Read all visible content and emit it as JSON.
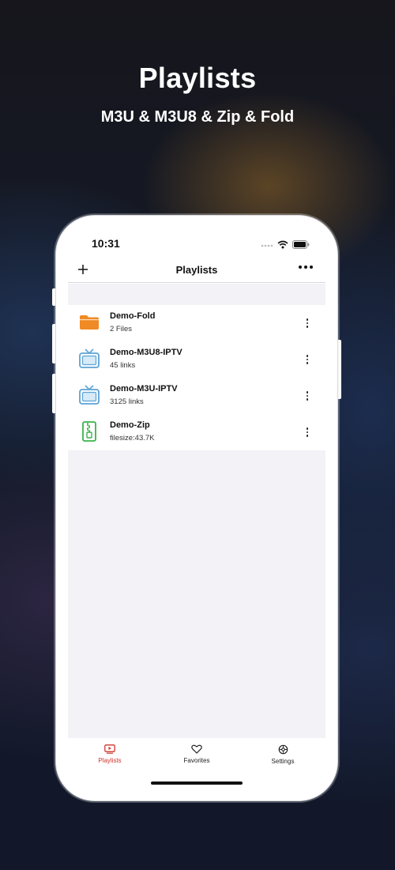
{
  "promo": {
    "headline": "Playlists",
    "subheadline": "M3U & M3U8 & Zip & Fold"
  },
  "status_bar": {
    "time": "10:31"
  },
  "navbar": {
    "title": "Playlists",
    "add_icon": "plus-icon",
    "more_icon": "more-horizontal-icon"
  },
  "playlists": [
    {
      "title": "Demo-Fold",
      "subtitle": "2 Files",
      "icon": "folder-icon",
      "icon_color": "#f08a24"
    },
    {
      "title": "Demo-M3U8-IPTV",
      "subtitle": "45 links",
      "icon": "tv-icon",
      "icon_color": "#5ba3d6"
    },
    {
      "title": "Demo-M3U-IPTV",
      "subtitle": "3125 links",
      "icon": "tv-icon",
      "icon_color": "#5ba3d6"
    },
    {
      "title": "Demo-Zip",
      "subtitle": "filesize:43.7K",
      "icon": "zip-file-icon",
      "icon_color": "#3bb34a"
    }
  ],
  "tabbar": {
    "tabs": [
      {
        "label": "Playlists",
        "icon": "playlist-icon",
        "active": true
      },
      {
        "label": "Favorites",
        "icon": "heart-icon",
        "active": false
      },
      {
        "label": "Settings",
        "icon": "settings-icon",
        "active": false
      }
    ]
  },
  "colors": {
    "accent": "#d0352e",
    "list_background": "#f2f2f7"
  }
}
